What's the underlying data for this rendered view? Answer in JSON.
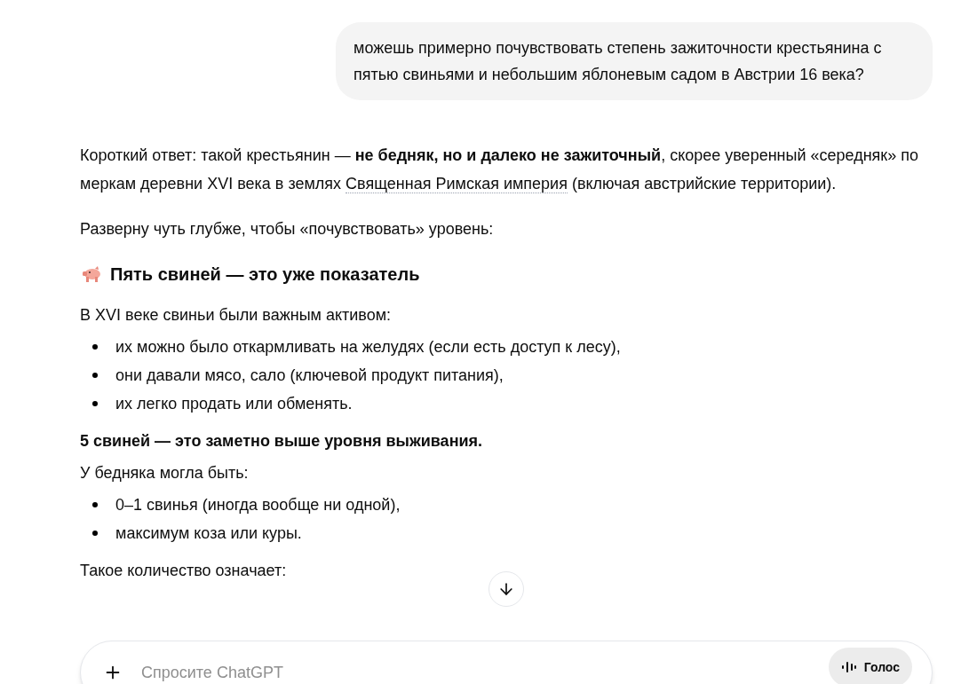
{
  "user_message": "можешь примерно почувствовать степень зажиточности крестьянина с пятью свиньями и небольшим яблоневым садом в Австрии 16 века?",
  "answer": [
    {
      "kind": "intro",
      "before": "Короткий ответ: такой крестьянин — **не бедняк, но и далеко не зажиточный**, скорее уверенный «середняк» по меркам деревни XVI века в землях ",
      "link": "Священная Римская империя",
      "after": " (включая австрийские территории)."
    },
    {
      "kind": "paragraph",
      "text": "Разверну чуть глубже, чтобы «почувствовать» уровень:"
    },
    {
      "kind": "heading",
      "text": "Пять свиней — это уже показатель"
    },
    {
      "kind": "lead",
      "text": "В XVI веке свиньи были важным активом:"
    },
    {
      "kind": "list",
      "items": [
        "их можно было откармливать на желудях (если есть доступ к лесу),",
        "они давали мясо, сало (ключевой продукт питания),",
        "их легко продать или обменять."
      ]
    },
    {
      "kind": "strong",
      "text": "5 свиней — это заметно выше уровня выживания."
    },
    {
      "kind": "lead",
      "text": "У бедняка могла быть:"
    },
    {
      "kind": "list",
      "items": [
        "0–1 свинья (иногда вообще ни одной),",
        "максимум коза или куры."
      ]
    },
    {
      "kind": "lead",
      "text": "Такое количество означает:"
    }
  ],
  "composer": {
    "placeholder": "Спросите ChatGPT",
    "voice_label": "Голос"
  }
}
